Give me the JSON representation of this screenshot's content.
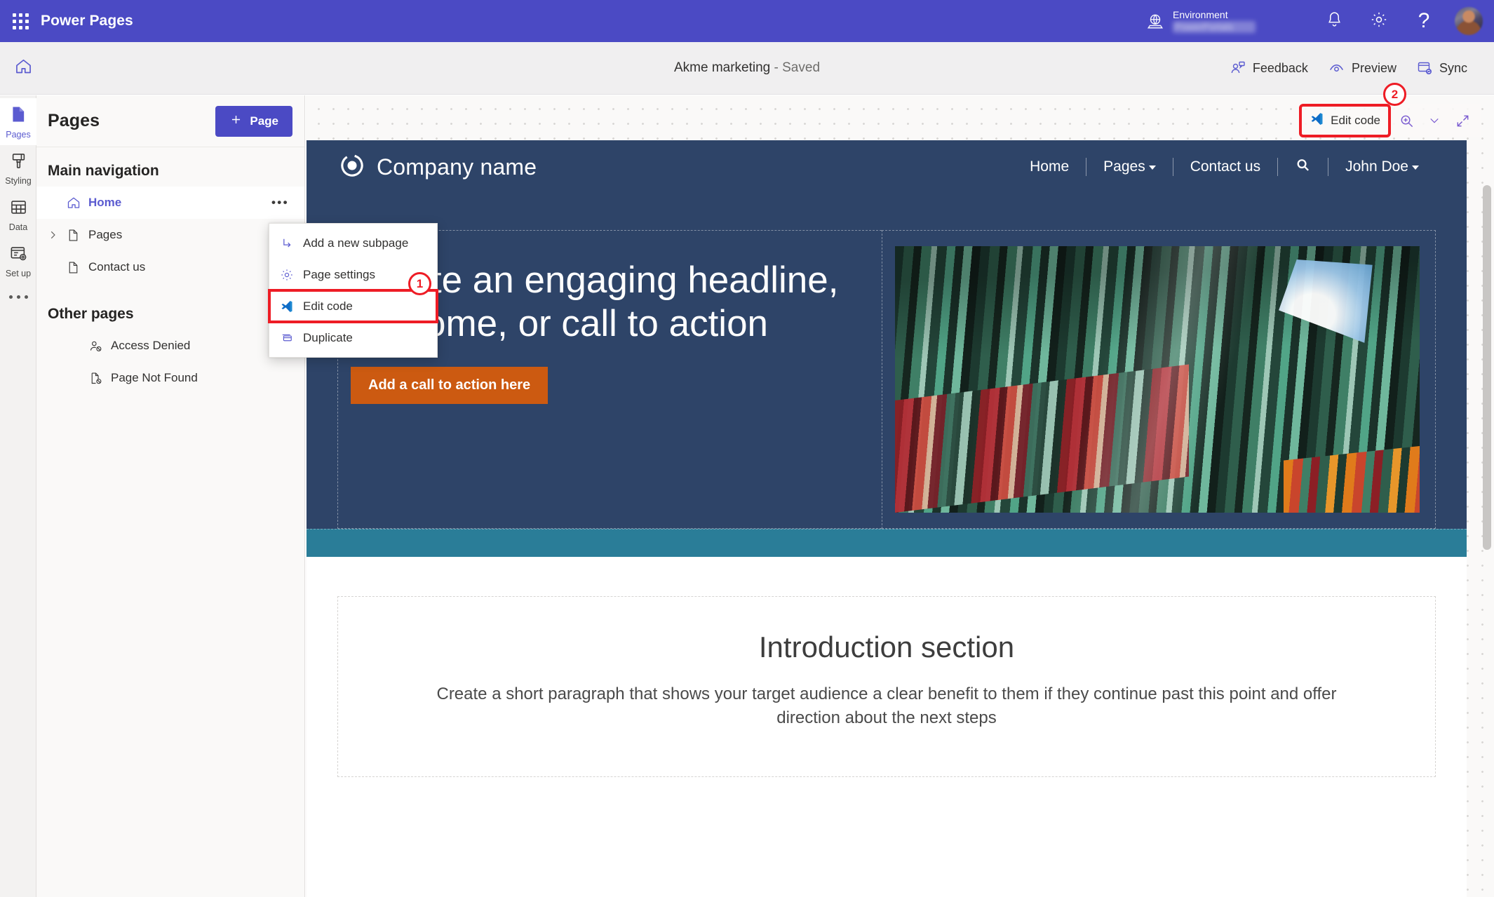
{
  "suite": {
    "app_title": "Power Pages",
    "waffle_icon": "app-launcher-icon",
    "environment_label": "Environment",
    "environment_name": "PowerPortals",
    "globe_icon": "environment-globe-icon",
    "notifications_icon": "bell-icon",
    "settings_icon": "gear-icon",
    "help_icon": "question-mark-icon",
    "avatar_icon": "user-avatar"
  },
  "command_bar": {
    "home_icon": "home-icon",
    "doc_title": "Akme marketing",
    "doc_status": " - Saved",
    "actions": [
      {
        "label": "Feedback",
        "icon": "feedback-people-icon"
      },
      {
        "label": "Preview",
        "icon": "eye-preview-icon"
      },
      {
        "label": "Sync",
        "icon": "sync-browser-icon"
      }
    ]
  },
  "rail": {
    "items": [
      {
        "label": "Pages",
        "icon": "page-file-icon",
        "active": true
      },
      {
        "label": "Styling",
        "icon": "paint-brush-icon",
        "active": false
      },
      {
        "label": "Data",
        "icon": "table-grid-icon",
        "active": false
      },
      {
        "label": "Set up",
        "icon": "setup-window-gear-icon",
        "active": false
      }
    ],
    "more_label": "More",
    "more_icon": "ellipsis-icon"
  },
  "pages_panel": {
    "title": "Pages",
    "add_button": "Page",
    "add_button_icon": "plus-icon",
    "main_navigation_title": "Main navigation",
    "main_navigation": [
      {
        "label": "Home",
        "icon": "home-outline-icon",
        "selected": true,
        "expandable": false,
        "overflow_icon": "ellipsis-icon"
      },
      {
        "label": "Pages",
        "icon": "page-file-outline-icon",
        "selected": false,
        "expandable": true,
        "chevron_icon": "chevron-right-icon"
      },
      {
        "label": "Contact us",
        "icon": "page-file-outline-icon",
        "selected": false,
        "expandable": false
      }
    ],
    "other_pages_title": "Other pages",
    "other_pages": [
      {
        "label": "Access Denied",
        "icon": "person-blocked-icon"
      },
      {
        "label": "Page Not Found",
        "icon": "page-blocked-icon"
      }
    ]
  },
  "context_menu": {
    "items": [
      {
        "label": "Add a new subpage",
        "icon": "subpage-arrow-icon",
        "highlighted": false
      },
      {
        "label": "Page settings",
        "icon": "gear-icon",
        "highlighted": false
      },
      {
        "label": "Edit code",
        "icon": "vscode-icon",
        "highlighted": true
      },
      {
        "label": "Duplicate",
        "icon": "duplicate-icon",
        "highlighted": false
      }
    ]
  },
  "callouts": [
    {
      "number": "1"
    },
    {
      "number": "2"
    }
  ],
  "canvas_tools": {
    "edit_code_label": "Edit code",
    "edit_code_icon": "vscode-icon",
    "zoom_icon": "zoom-in-magnifier-icon",
    "zoom_chevron_icon": "chevron-down-icon",
    "fullscreen_icon": "expand-diagonal-icon"
  },
  "site_preview": {
    "brand_icon": "circle-logo-icon",
    "brand_name": "Company name",
    "nav": [
      {
        "label": "Home",
        "has_caret": false
      },
      {
        "label": "Pages",
        "has_caret": true
      },
      {
        "label": "Contact us",
        "has_caret": false
      },
      {
        "label": "",
        "icon": "search-icon",
        "has_caret": false
      },
      {
        "label": "John Doe",
        "has_caret": true
      }
    ],
    "hero": {
      "headline": "Create an engaging headline, welcome, or call to action",
      "cta_label": "Add a call to action here",
      "image_alt": "colorful-panels-photo",
      "background_color": "#2e4468",
      "cta_color": "#cc5a11"
    },
    "accent_band_color": "#2a7d98",
    "intro": {
      "title": "Introduction section",
      "body": "Create a short paragraph that shows your target audience a clear benefit to them if they continue past this point and offer direction about the next steps"
    }
  },
  "colors": {
    "suite_bar": "#4b4ac4",
    "accent": "#5b5bd0",
    "callout_red": "#ee1c25",
    "site_navy": "#2e4468"
  }
}
